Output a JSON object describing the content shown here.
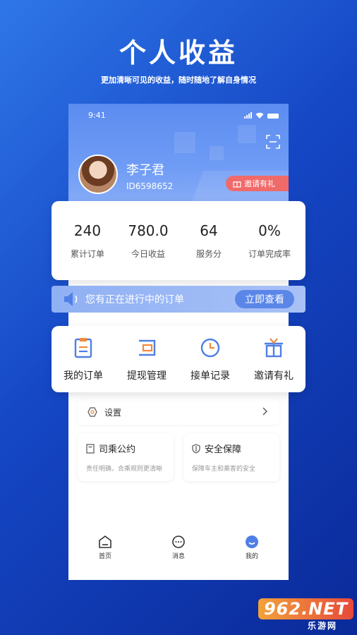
{
  "promo": {
    "title": "个人收益",
    "subtitle": "更加清晰可见的收益，随时随地了解自身情况"
  },
  "status_bar": {
    "time": "9:41"
  },
  "profile": {
    "name": "李子君",
    "id": "ID6598652",
    "invite_badge": "邀请有礼"
  },
  "stats": [
    {
      "value": "240",
      "label": "累计订单"
    },
    {
      "value": "780.0",
      "label": "今日收益"
    },
    {
      "value": "64",
      "label": "服务分"
    },
    {
      "value": "0%",
      "label": "订单完成率"
    }
  ],
  "notice": {
    "text": "您有正在进行中的订单",
    "button": "立即查看"
  },
  "menu": [
    {
      "label": "我的订单",
      "icon": "clipboard-icon"
    },
    {
      "label": "提现管理",
      "icon": "wallet-icon"
    },
    {
      "label": "接单记录",
      "icon": "clock-icon"
    },
    {
      "label": "邀请有礼",
      "icon": "gift-icon"
    }
  ],
  "settings": {
    "label": "设置"
  },
  "info_cards": [
    {
      "title": "司乘公约",
      "desc": "责任明确，合乘规则更清晰",
      "icon": "document-icon"
    },
    {
      "title": "安全保障",
      "desc": "保障车主和乘客的安全",
      "icon": "shield-icon"
    }
  ],
  "tabs": [
    {
      "label": "首页",
      "icon": "home-icon"
    },
    {
      "label": "消息",
      "icon": "message-icon"
    },
    {
      "label": "我的",
      "icon": "profile-icon",
      "active": true
    }
  ],
  "watermark": {
    "logo": "962.NET",
    "sub": "乐游网"
  },
  "colors": {
    "accent": "#4f7fe6",
    "badge": "#f06a6a",
    "icon_orange": "#f08a3c",
    "icon_blue": "#4f7fe6"
  }
}
